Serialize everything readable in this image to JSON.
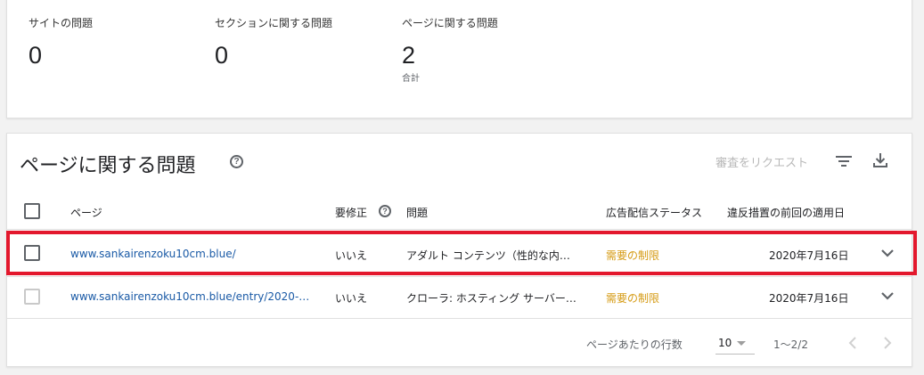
{
  "summary": {
    "site_issues": {
      "label": "サイトの問題",
      "value": "0"
    },
    "section_issues": {
      "label": "セクションに関する問題",
      "value": "0"
    },
    "page_issues": {
      "label": "ページに関する問題",
      "value": "2",
      "sub": "合計"
    }
  },
  "issues_card": {
    "title": "ページに関する問題",
    "help_glyph": "?",
    "request_review_label": "審査をリクエスト",
    "icons": [
      "help-circle-icon",
      "filter-icon",
      "download-icon",
      "chevron-down-icon",
      "chevron-left-icon",
      "chevron-right-icon"
    ],
    "columns": {
      "page": "ページ",
      "needs_fix": "要修正",
      "issue": "問題",
      "ad_status": "広告配信ステータス",
      "last_enforced": "違反措置の前回の適用日"
    },
    "rows": [
      {
        "page": "www.sankairenzoku10cm.blue/",
        "needs_fix": "いいえ",
        "issue": "アダルト コンテンツ（性的な内…",
        "ad_status": "需要の制限",
        "date": "2020年7月16日"
      },
      {
        "page": "www.sankairenzoku10cm.blue/entry/2020-…",
        "needs_fix": "いいえ",
        "issue": "クローラ: ホスティング サーバー…",
        "ad_status": "需要の制限",
        "date": "2020年7月16日"
      }
    ],
    "footer": {
      "rows_per_page_label": "ページあたりの行数",
      "rows_per_page_value": "10",
      "range": "1〜2/2"
    }
  },
  "colors": {
    "link": "#1a5aa6",
    "status_warning": "#d59a12",
    "highlight": "#e3182d"
  }
}
